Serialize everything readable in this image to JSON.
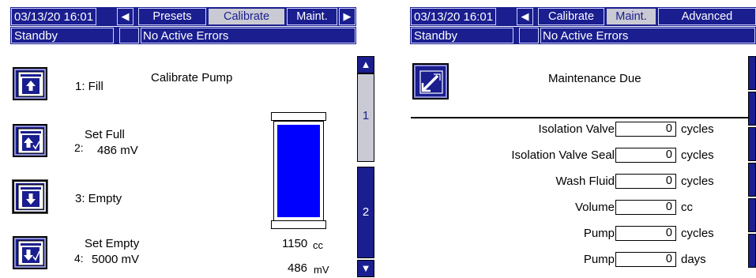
{
  "left": {
    "datetime": "03/13/20 16:01",
    "tabs": [
      "Presets",
      "Calibrate",
      "Maint."
    ],
    "active_tab": "Calibrate",
    "status": {
      "mode": "Standby",
      "errors": "No Active Errors"
    },
    "title": "Calibrate Pump",
    "steps": [
      {
        "label": "1: Fill",
        "icon": "fill-up-arrow-icon"
      },
      {
        "label_num": "2:",
        "label": "Set Full",
        "value": "486 mV",
        "icon": "set-full-arrow-check-icon"
      },
      {
        "label": "3: Empty",
        "icon": "empty-down-arrow-icon"
      },
      {
        "label_num": "4:",
        "label": "Set Empty",
        "value": "5000 mV",
        "icon": "set-empty-arrow-check-icon"
      }
    ],
    "gauge": {
      "level": 1.0,
      "volume_value": "1150",
      "volume_unit": "cc",
      "voltage_value": "486",
      "voltage_unit": "mV"
    },
    "pages": [
      "1",
      "2"
    ],
    "active_page": "1"
  },
  "right": {
    "datetime": "03/13/20 16:01",
    "tabs": [
      "Calibrate",
      "Maint.",
      "Advanced"
    ],
    "active_tab": "Maint.",
    "status": {
      "mode": "Standby",
      "errors": "No Active Errors"
    },
    "title": "Maintenance Due",
    "rows": [
      {
        "label": "Isolation Valve",
        "value": "0",
        "unit": "cycles"
      },
      {
        "label": "Isolation Valve Seal",
        "value": "0",
        "unit": "cycles"
      },
      {
        "label": "Wash Fluid",
        "value": "0",
        "unit": "cycles"
      },
      {
        "label": "Volume",
        "value": "0",
        "unit": "cc"
      },
      {
        "label": "Pump",
        "value": "0",
        "unit": "cycles"
      },
      {
        "label": "Pump",
        "value": "0",
        "unit": "days"
      }
    ]
  },
  "colors": {
    "header_blue": "#1a1e8f",
    "gauge_fill": "#0000ff",
    "active_tab_bg": "#c9cad3"
  }
}
